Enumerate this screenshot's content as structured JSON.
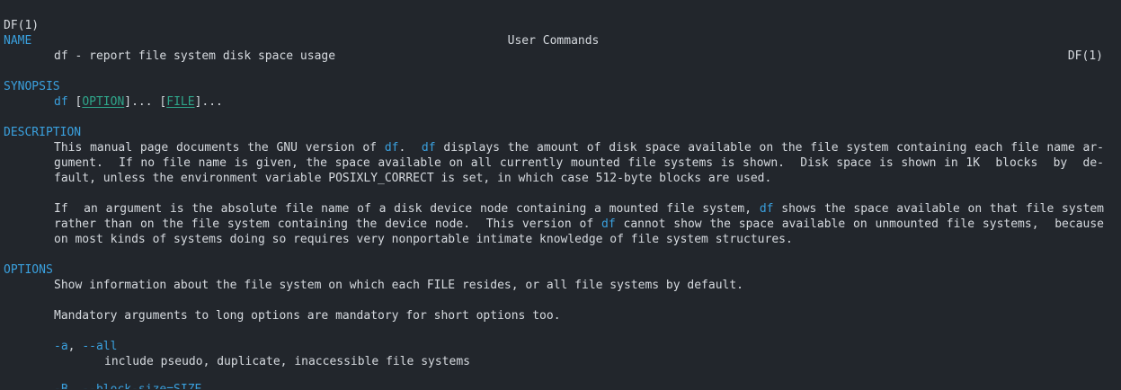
{
  "header": {
    "left": "DF(1)",
    "center": "User Commands",
    "right": "DF(1)"
  },
  "name_section": {
    "heading": "NAME",
    "text": "df - report file system disk space usage"
  },
  "synopsis_section": {
    "heading": "SYNOPSIS",
    "cmd": "df",
    "sp": " ",
    "lb1": "[",
    "arg1": "OPTION",
    "mid": "]... [",
    "arg2": "FILE",
    "end": "]..."
  },
  "description_section": {
    "heading": "DESCRIPTION",
    "p1": {
      "l1a": "This manual page documents the GNU version of ",
      "l1cmd1": "df",
      "l1b": ".  ",
      "l1cmd2": "df",
      "l1c": " displays the amount of disk space available on the file system containing each file name ar-",
      "l2": "gument.  If no file name is given, the space available on all currently mounted file systems is shown.  Disk space is shown in 1K  blocks  by  de-",
      "l3": "fault, unless the environment variable POSIXLY_CORRECT is set, in which case 512-byte blocks are used."
    },
    "p2": {
      "l1a": "If  an argument is the absolute file name of a disk device node containing a mounted file system, ",
      "l1cmd": "df",
      "l1b": " shows the space available on that file system",
      "l2a": "rather than on the file system containing the device node.  This version of ",
      "l2cmd": "df",
      "l2b": " cannot show the space available on unmounted file systems,  because",
      "l3": "on most kinds of systems doing so requires very nonportable intimate knowledge of file system structures."
    }
  },
  "options_section": {
    "heading": "OPTIONS",
    "intro": "Show information about the file system on which each FILE resides, or all file systems by default.",
    "mandatory": "Mandatory arguments to long options are mandatory for short options too.",
    "opt_all": {
      "flag_short": "-a",
      "sep": ", ",
      "flag_long": "--all",
      "desc": "include pseudo, duplicate, inaccessible file systems"
    },
    "opt_block_size": {
      "flag": "-B, --block-size=SIZE"
    }
  },
  "colors": {
    "background": "#22262c",
    "text": "#d6dadf",
    "heading": "#3aa0de",
    "argument": "#2fa58a"
  }
}
